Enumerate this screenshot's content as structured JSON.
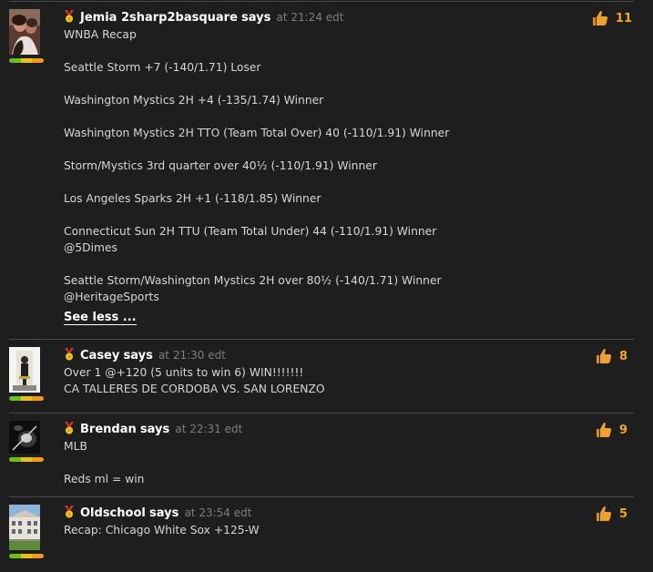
{
  "posts": [
    {
      "author": "Jemia 2sharp2basquare",
      "says": "says",
      "at": "at 21:24 edt",
      "likes": "11",
      "lines": [
        "WNBA Recap",
        "",
        "Seattle Storm +7 (-140/1.71) Loser",
        "",
        "Washington Mystics 2H +4 (-135/1.74) Winner",
        "",
        "Washington Mystics 2H TTO (Team Total Over) 40 (-110/1.91) Winner",
        "",
        "Storm/Mystics 3rd quarter over 40½ (-110/1.91) Winner",
        "",
        "Los Angeles Sparks 2H +1 (-118/1.85) Winner",
        "",
        "Connecticut Sun 2H TTU (Team Total Under) 44 (-110/1.91) Winner",
        "@5Dimes",
        "",
        "Seattle Storm/Washington Mystics 2H over 80½ (-140/1.71) Winner",
        "@HeritageSports"
      ],
      "see_less": "See less ..."
    },
    {
      "author": "Casey",
      "says": "says",
      "at": "at 21:30 edt",
      "likes": "8",
      "lines": [
        "Over 1 @+120 (5 units to win 6) WIN!!!!!!!",
        "CA TALLERES DE CORDOBA VS. SAN LORENZO"
      ]
    },
    {
      "author": "Brendan",
      "says": "says",
      "at": "at 22:31 edt",
      "likes": "9",
      "lines": [
        "MLB",
        "",
        "Reds ml = win"
      ]
    },
    {
      "author": "Oldschool",
      "says": "says",
      "at": "at 23:54 edt",
      "likes": "5",
      "lines": [
        "Recap: Chicago White Sox +125-W"
      ]
    }
  ],
  "colors": {
    "background": "#1e1e1e",
    "like_count": "#f7a325",
    "thumb": "#f0a030",
    "separator": "#4a4a4a"
  },
  "icons": {
    "medal": "medal-icon",
    "like": "thumbs-up-icon"
  }
}
